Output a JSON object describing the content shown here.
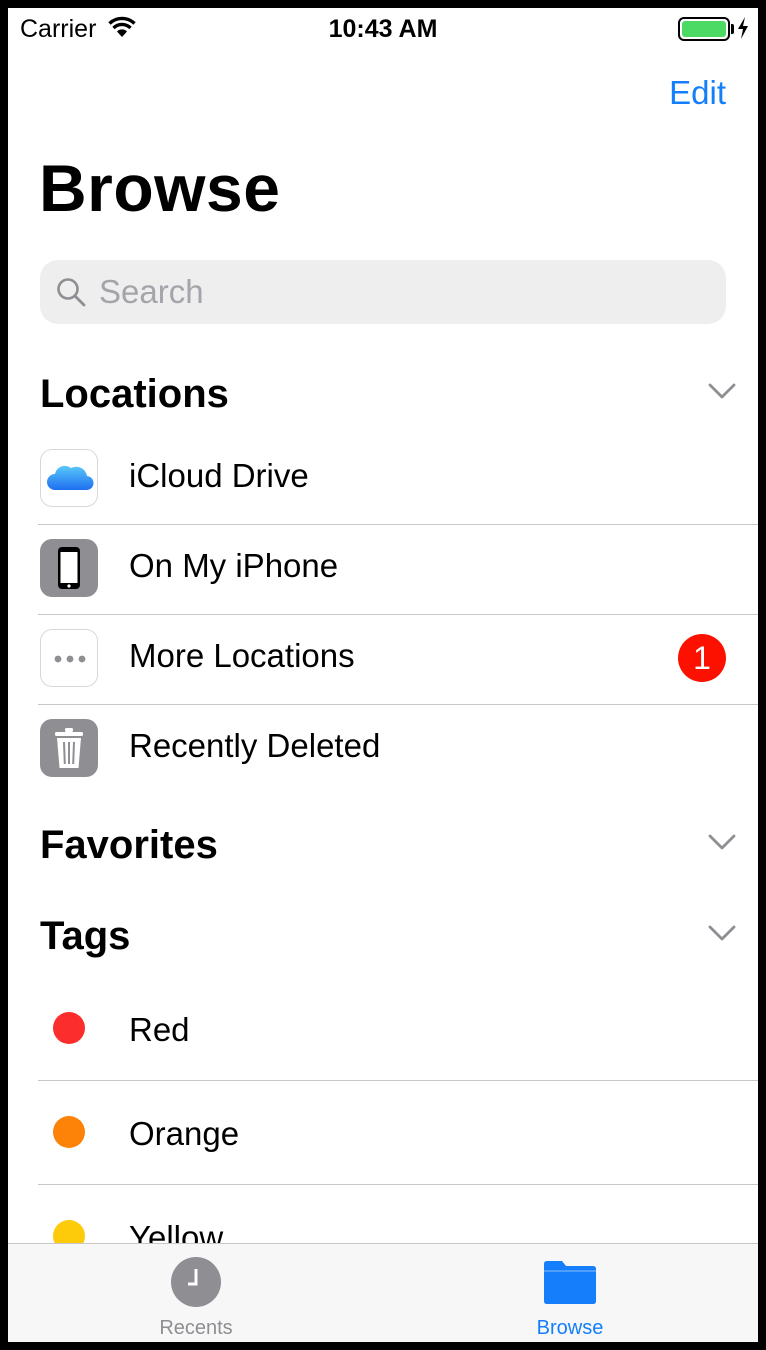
{
  "status_bar": {
    "carrier": "Carrier",
    "time": "10:43 AM",
    "battery_color": "#4cd964"
  },
  "nav": {
    "edit_label": "Edit",
    "title": "Browse"
  },
  "search": {
    "placeholder": "Search"
  },
  "sections": {
    "locations": {
      "title": "Locations",
      "items": [
        {
          "label": "iCloud Drive",
          "icon": "icloud-icon"
        },
        {
          "label": "On My iPhone",
          "icon": "iphone-icon"
        },
        {
          "label": "More Locations",
          "icon": "more-icon",
          "badge": "1"
        },
        {
          "label": "Recently Deleted",
          "icon": "trash-icon"
        }
      ]
    },
    "favorites": {
      "title": "Favorites"
    },
    "tags": {
      "title": "Tags",
      "items": [
        {
          "label": "Red",
          "color": "#fc2d2d"
        },
        {
          "label": "Orange",
          "color": "#fd8208"
        },
        {
          "label": "Yellow",
          "color": "#fecb0a"
        }
      ]
    }
  },
  "tab_bar": {
    "tabs": [
      {
        "label": "Recents",
        "icon": "clock-icon",
        "active": false
      },
      {
        "label": "Browse",
        "icon": "folder-icon",
        "active": true
      }
    ],
    "active_color": "#147efb",
    "inactive_color": "#8e8e93"
  }
}
